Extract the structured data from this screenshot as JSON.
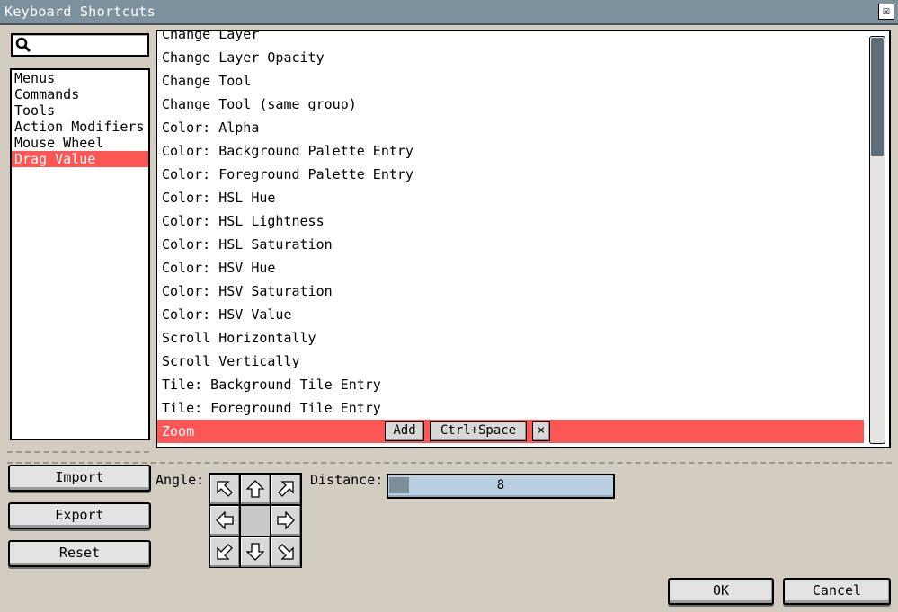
{
  "window": {
    "title": "Keyboard Shortcuts",
    "close_glyph": "☒"
  },
  "search": {
    "value": "",
    "placeholder": ""
  },
  "categories": [
    {
      "label": "Menus"
    },
    {
      "label": "Commands"
    },
    {
      "label": "Tools"
    },
    {
      "label": "Action Modifiers"
    },
    {
      "label": "Mouse Wheel"
    },
    {
      "label": "Drag Value",
      "selected": true
    }
  ],
  "shortcuts": [
    {
      "label": "Change Layer"
    },
    {
      "label": "Change Layer Opacity"
    },
    {
      "label": "Change Tool"
    },
    {
      "label": "Change Tool (same group)"
    },
    {
      "label": "Color: Alpha"
    },
    {
      "label": "Color: Background Palette Entry"
    },
    {
      "label": "Color: Foreground Palette Entry"
    },
    {
      "label": "Color: HSL Hue"
    },
    {
      "label": "Color: HSL Lightness"
    },
    {
      "label": "Color: HSL Saturation"
    },
    {
      "label": "Color: HSV Hue"
    },
    {
      "label": "Color: HSV Saturation"
    },
    {
      "label": "Color: HSV Value"
    },
    {
      "label": "Scroll Horizontally"
    },
    {
      "label": "Scroll Vertically"
    },
    {
      "label": "Tile: Background Tile Entry"
    },
    {
      "label": "Tile: Foreground Tile Entry"
    },
    {
      "label": "Zoom",
      "selected": true
    }
  ],
  "selected_row": {
    "add_label": "Add",
    "key_label": "Ctrl+Space",
    "remove_label": "×"
  },
  "buttons": {
    "import": "Import",
    "export": "Export",
    "reset": "Reset",
    "ok": "OK",
    "cancel": "Cancel"
  },
  "angle": {
    "label": "Angle:"
  },
  "distance": {
    "label": "Distance:",
    "value": "8",
    "fraction": 0.05
  },
  "colors": {
    "selection": "#fe5555",
    "titlebar": "#7d929e",
    "background": "#d3ccc1",
    "slider": "#b9d0e3"
  }
}
